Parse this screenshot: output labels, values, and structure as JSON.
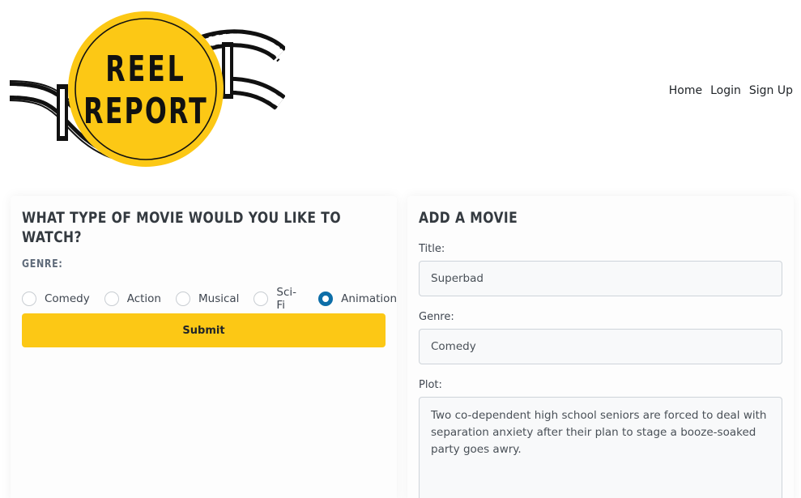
{
  "logo": {
    "line1": "REEL",
    "line2": "REPORT"
  },
  "nav": {
    "items": [
      "Home",
      "Login",
      "Sign Up"
    ]
  },
  "left_card": {
    "title": "What type of movie would you like to watch?",
    "genre_heading": "Genre:",
    "options": [
      {
        "label": "Comedy",
        "checked": false
      },
      {
        "label": "Action",
        "checked": false
      },
      {
        "label": "Musical",
        "checked": false
      },
      {
        "label": "Sci-Fi",
        "checked": false
      },
      {
        "label": "Animation",
        "checked": true
      }
    ],
    "submit_label": "Submit"
  },
  "right_card": {
    "title": "Add a Movie",
    "title_label": "Title:",
    "title_value": "Superbad",
    "genre_label": "Genre:",
    "genre_value": "Comedy",
    "plot_label": "Plot:",
    "plot_value": "Two co-dependent high school seniors are forced to deal with separation anxiety after their plan to stage a booze-soaked party goes awry."
  },
  "colors": {
    "accent_yellow": "#fcc815",
    "radio_checked": "#0d6ea8",
    "heading": "#343a40"
  }
}
